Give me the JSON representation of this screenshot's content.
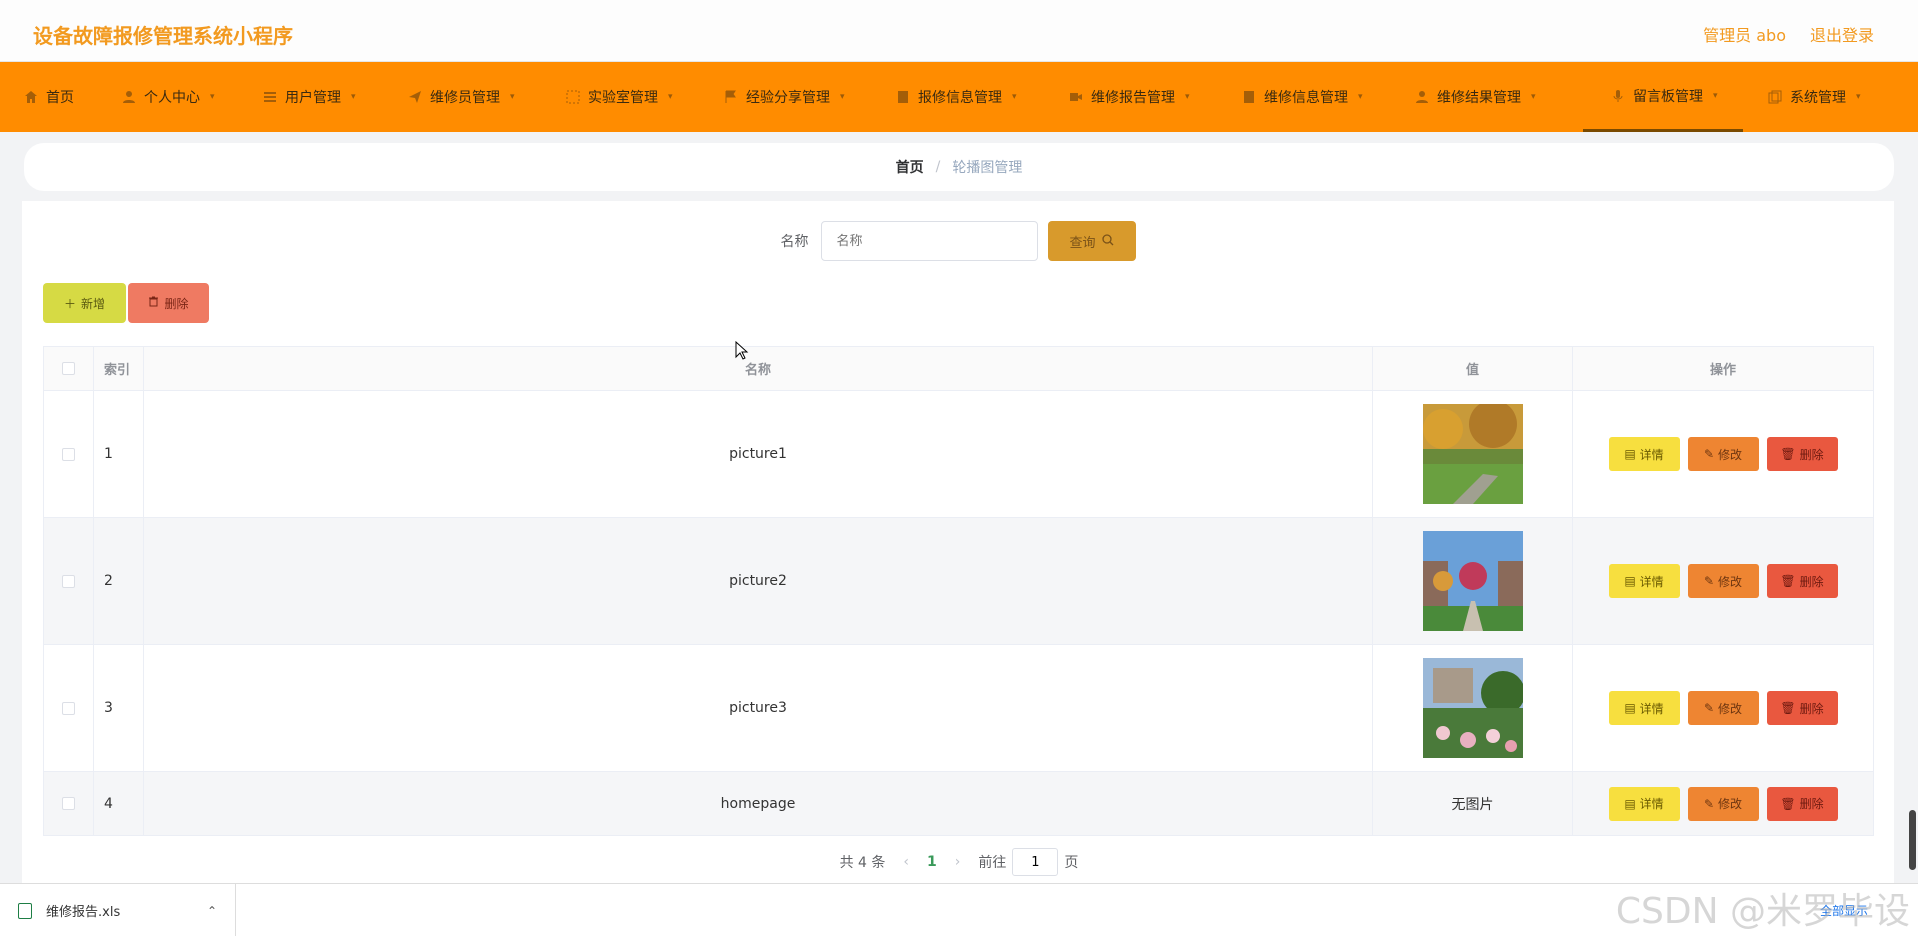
{
  "header": {
    "title": "设备故障报修管理系统小程序",
    "admin": "管理员 abo",
    "logout": "退出登录"
  },
  "nav": [
    {
      "label": "首页",
      "icon": "home-icon",
      "caret": false
    },
    {
      "label": "个人中心",
      "icon": "user-icon",
      "caret": true
    },
    {
      "label": "用户管理",
      "icon": "list-icon",
      "caret": true
    },
    {
      "label": "维修员管理",
      "icon": "send-icon",
      "caret": true
    },
    {
      "label": "实验室管理",
      "icon": "frame-icon",
      "caret": true
    },
    {
      "label": "经验分享管理",
      "icon": "flag-icon",
      "caret": true
    },
    {
      "label": "报修信息管理",
      "icon": "doc-icon",
      "caret": true
    },
    {
      "label": "维修报告管理",
      "icon": "video-icon",
      "caret": true
    },
    {
      "label": "维修信息管理",
      "icon": "doc-icon",
      "caret": true
    },
    {
      "label": "维修结果管理",
      "icon": "person-icon",
      "caret": true
    },
    {
      "label": "留言板管理",
      "icon": "mic-icon",
      "caret": true
    },
    {
      "label": "系统管理",
      "icon": "copy-icon",
      "caret": true
    }
  ],
  "breadcrumb": {
    "home": "首页",
    "separator": "/",
    "current": "轮播图管理"
  },
  "search": {
    "label": "名称",
    "placeholder": "名称",
    "button": "查询"
  },
  "actions": {
    "add": "新增",
    "delete": "删除"
  },
  "table": {
    "headers": {
      "index": "索引",
      "name": "名称",
      "value": "值",
      "ops": "操作"
    },
    "rows": [
      {
        "index": "1",
        "name": "picture1",
        "value": "image",
        "thumb": "autumn-park"
      },
      {
        "index": "2",
        "name": "picture2",
        "value": "image",
        "thumb": "garden-path"
      },
      {
        "index": "3",
        "name": "picture3",
        "value": "image",
        "thumb": "rose-garden"
      },
      {
        "index": "4",
        "name": "homepage",
        "value": "无图片",
        "thumb": null
      }
    ],
    "op_labels": {
      "detail": "详情",
      "edit": "修改",
      "delete": "删除"
    }
  },
  "pagination": {
    "total": "共 4 条",
    "current": "1",
    "goto_prefix": "前往",
    "goto_value": "1",
    "goto_suffix": "页"
  },
  "download": {
    "file": "维修报告.xls",
    "show_all": "全部显示"
  },
  "watermark": "CSDN @米罗毕设",
  "colors": {
    "brand": "#f29a20",
    "nav_bg": "#ff8c00",
    "search_btn": "#d89a2c",
    "add_btn": "#d6da44",
    "del_btn": "#ef7a62",
    "op_detail": "#f7df3f",
    "op_edit": "#ee8532",
    "op_delete": "#e9583f"
  }
}
